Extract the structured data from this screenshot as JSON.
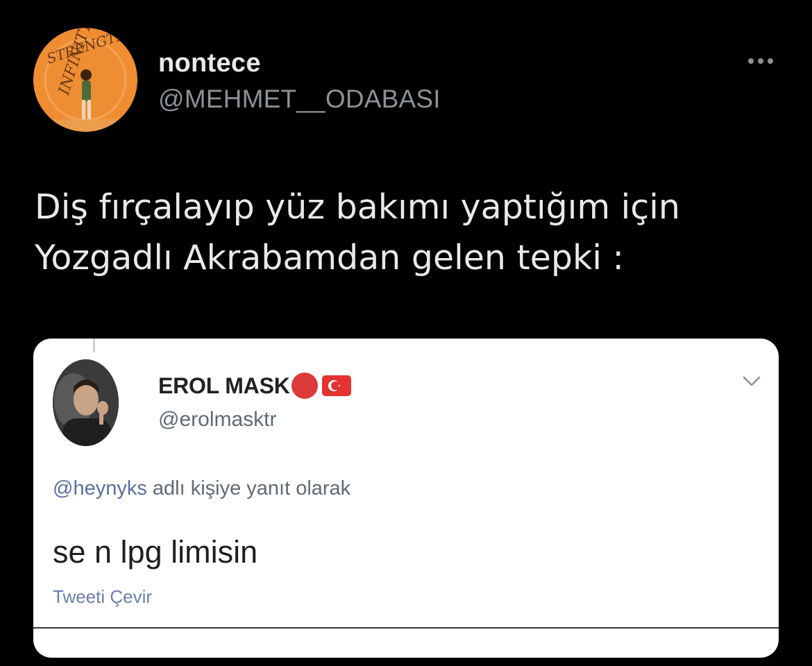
{
  "tweet": {
    "author": {
      "display_name": "nontece",
      "handle": "@MEHMET__ODABASI",
      "avatar_icon": "orange-album-cover-avatar",
      "avatar_lettering": "STRENGTH INFINITY"
    },
    "more_icon": "more-horizontal-icon",
    "text_line_1": "Diş fırçalayıp yüz bakımı yaptığım için",
    "text_line_2": "Yozgadlı Akrabamdan gelen tepki :"
  },
  "embedded_screenshot": {
    "author": {
      "display_name": "EROL MASK",
      "handle": "@erolmasktr",
      "avatar_icon": "profile-photo-avatar",
      "emoji_1": "red-circle-emoji",
      "emoji_2": "turkey-flag-emoji"
    },
    "chevron_icon": "chevron-down-icon",
    "reply_to_handle": "@heynyks",
    "reply_suffix": " adlı kişiye yanıt olarak",
    "text": "se n lpg limisin",
    "translate_label": "Tweeti Çevir"
  },
  "colors": {
    "background": "#000000",
    "primary_text": "#e7e9ea",
    "secondary_text": "#8b9196",
    "card_background": "#ffffff",
    "link": "#6b7fae",
    "flag_red": "#e3322f"
  }
}
